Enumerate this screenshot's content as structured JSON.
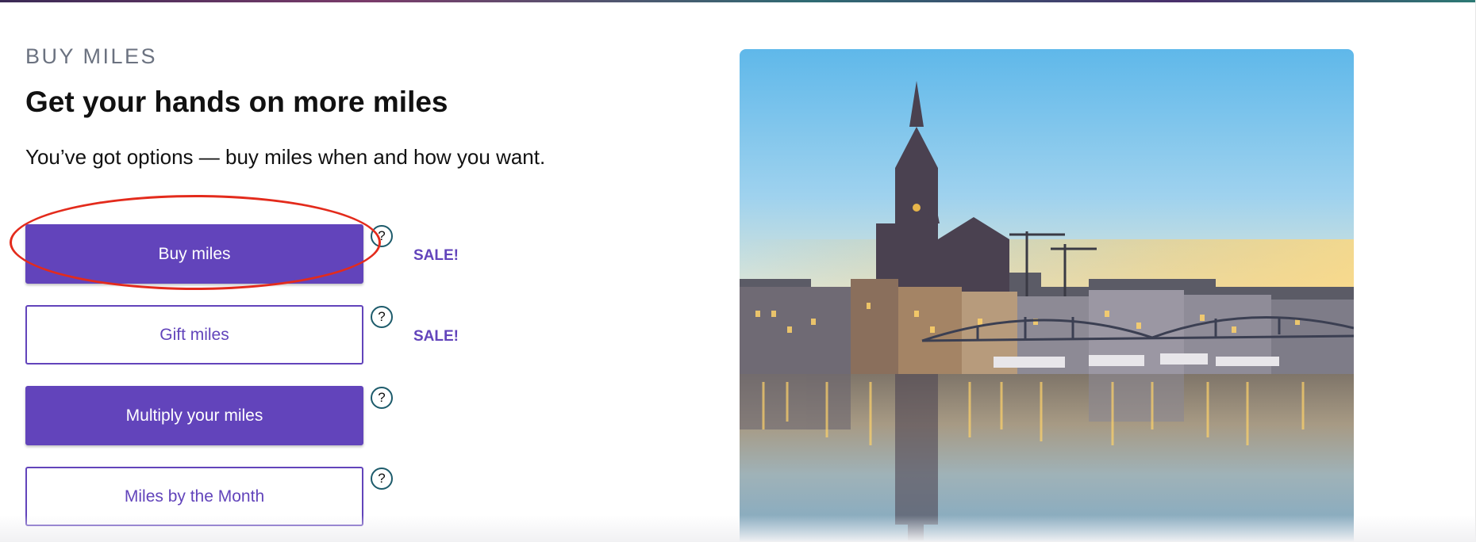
{
  "section": {
    "eyebrow": "BUY MILES",
    "headline": "Get your hands on more miles",
    "subtext": "You’ve got options — buy miles when and how you want."
  },
  "options": [
    {
      "label": "Buy miles",
      "style": "filled",
      "help": "?",
      "badge": "SALE!"
    },
    {
      "label": "Gift miles",
      "style": "outline",
      "help": "?",
      "badge": "SALE!"
    },
    {
      "label": "Multiply your miles",
      "style": "filled",
      "help": "?"
    },
    {
      "label": "Miles by the Month",
      "style": "outline",
      "help": "?"
    }
  ],
  "hero": {
    "icon": "city-skyline-photo"
  },
  "annotation": {
    "icon": "red-ellipse-highlight"
  },
  "colors": {
    "brand_purple": "#6244bb",
    "help_ring": "#1d5b6b",
    "annotation_red": "#e32b1c"
  }
}
